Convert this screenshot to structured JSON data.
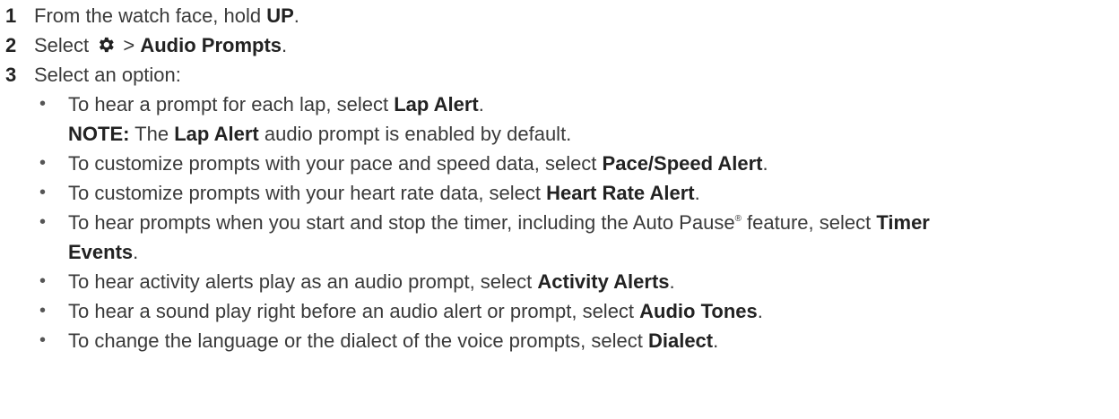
{
  "steps": [
    {
      "num": "1",
      "text": "From the watch face, hold ",
      "bold": "UP",
      "end": "."
    },
    {
      "num": "2",
      "pre": "Select ",
      "icon": "gear-icon",
      "mid": " > ",
      "bold": "Audio Prompts",
      "end": "."
    },
    {
      "num": "3",
      "text": "Select an option:"
    }
  ],
  "options": [
    {
      "text": "To hear a prompt for each lap, select ",
      "bold": "Lap Alert",
      "end": "."
    },
    {
      "text": "To customize prompts with your pace and speed data, select ",
      "bold": "Pace/Speed Alert",
      "end": "."
    },
    {
      "text": "To customize prompts with your heart rate data, select ",
      "bold": "Heart Rate Alert",
      "end": "."
    },
    {
      "text": "To hear prompts when you start and stop the timer, including the Auto Pause",
      "sup": "®",
      "text2": " feature, select ",
      "bold": "Timer",
      "bold2": "Events",
      "end": "."
    },
    {
      "text": "To hear activity alerts play as an audio prompt, select ",
      "bold": "Activity Alerts",
      "end": "."
    },
    {
      "text": "To hear a sound play right before an audio alert or prompt, select ",
      "bold": "Audio Tones",
      "end": "."
    },
    {
      "text": "To change the language or the dialect of the voice prompts, select ",
      "bold": "Dialect",
      "end": "."
    }
  ],
  "note": {
    "label": "NOTE:",
    "pre": " The ",
    "bold": "Lap Alert",
    "post": " audio prompt is enabled by default."
  },
  "bullet_char": "•"
}
